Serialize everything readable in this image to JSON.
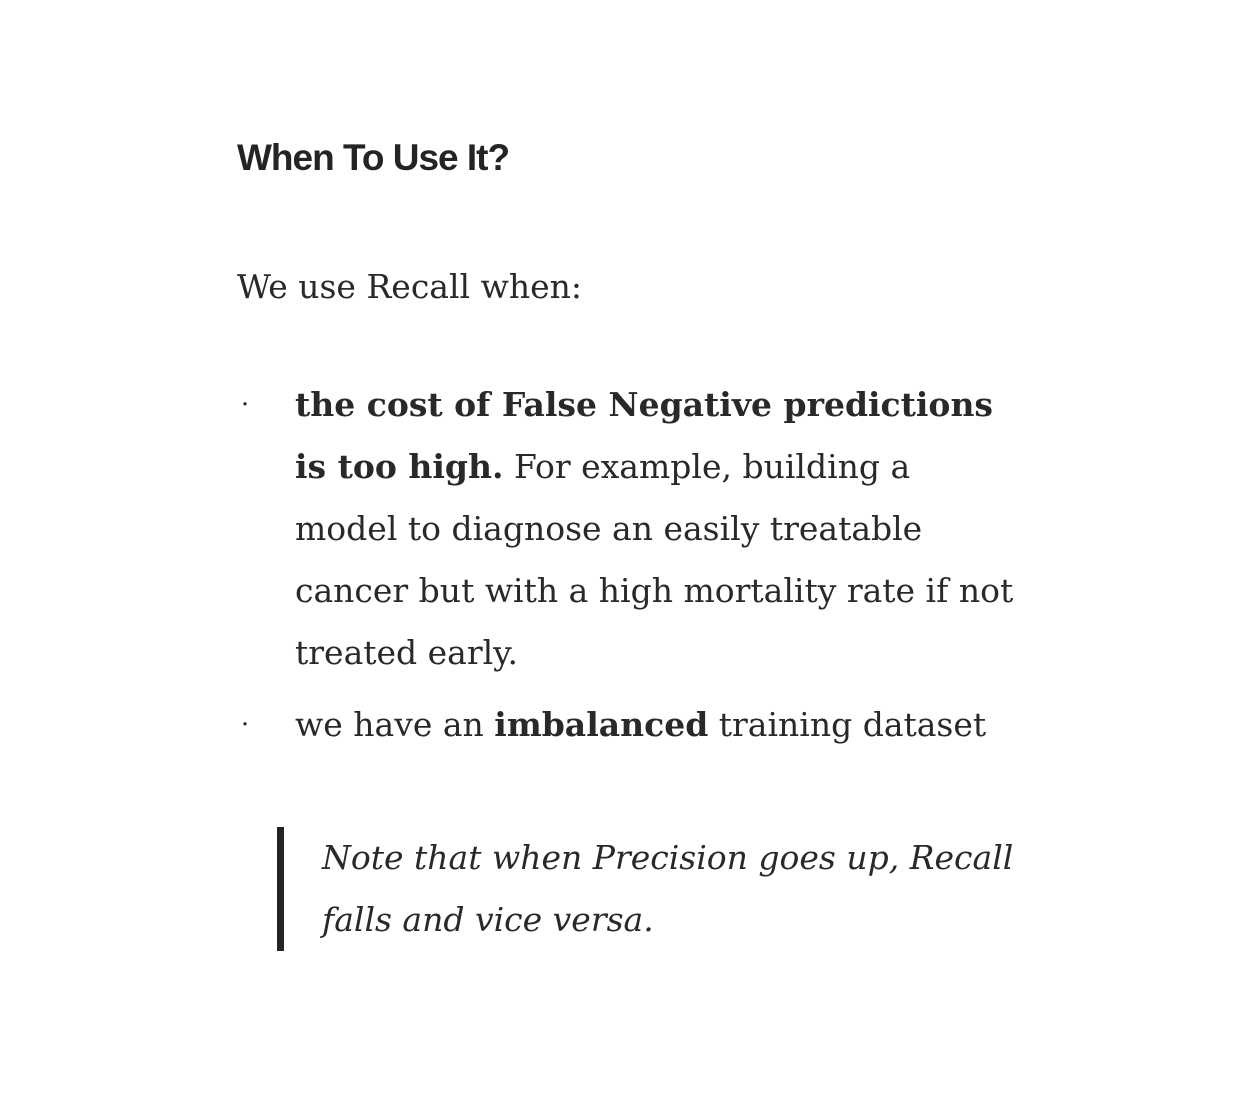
{
  "heading": "When To Use It?",
  "intro": "We use Recall when:",
  "bullets": [
    {
      "bold_lead": "the cost of False Negative predictions is too high.",
      "rest": " For example, building a model to diagnose an easily treatable cancer but with a high mortality rate if not treated early."
    },
    {
      "pre": "we have an ",
      "bold": "imbalanced",
      "post": " training dataset"
    }
  ],
  "bullet_glyph": "·",
  "quote": "Note that when Precision goes up, Recall falls and vice versa."
}
